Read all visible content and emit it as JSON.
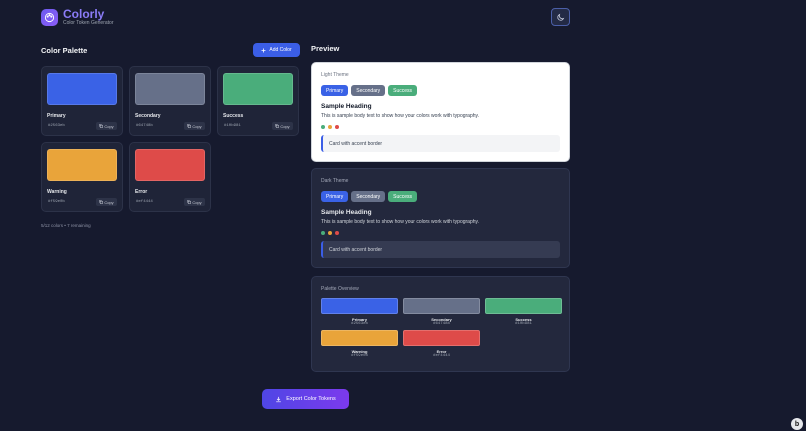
{
  "app": {
    "name": "Colorly",
    "subtitle": "Color Token Generator"
  },
  "palette": {
    "title": "Color Palette",
    "add_label": "Add Color",
    "copy_label": "Copy",
    "colors": [
      {
        "name": "Primary",
        "hex": "#2563eb",
        "color": "#3a62e6"
      },
      {
        "name": "Secondary",
        "hex": "#64748b",
        "color": "#667089"
      },
      {
        "name": "Success",
        "hex": "#10b981",
        "color": "#4aad7b"
      },
      {
        "name": "Warning",
        "hex": "#f59e0b",
        "color": "#e9a43a"
      },
      {
        "name": "Error",
        "hex": "#ef4444",
        "color": "#de4b49"
      }
    ],
    "count_text": "5/12 colors • 7 remaining"
  },
  "preview": {
    "title": "Preview",
    "light": {
      "label": "Light Theme",
      "buttons": [
        "Primary",
        "Secondary",
        "Success"
      ],
      "heading": "Sample Heading",
      "body": "This is sample body text to show how your colors work with typography.",
      "card_text": "Card with accent border"
    },
    "dark": {
      "label": "Dark Theme",
      "buttons": [
        "Primary",
        "Secondary",
        "Success"
      ],
      "heading": "Sample Heading",
      "body": "This is sample body text to show how your colors work with typography.",
      "card_text": "Card with accent border"
    },
    "overview": {
      "label": "Palette Overview"
    }
  },
  "export_label": "Export Color Tokens",
  "icons": {
    "logo": "palette-icon",
    "theme": "moon-icon",
    "add": "plus-icon",
    "copy": "copy-icon",
    "export": "download-icon"
  }
}
